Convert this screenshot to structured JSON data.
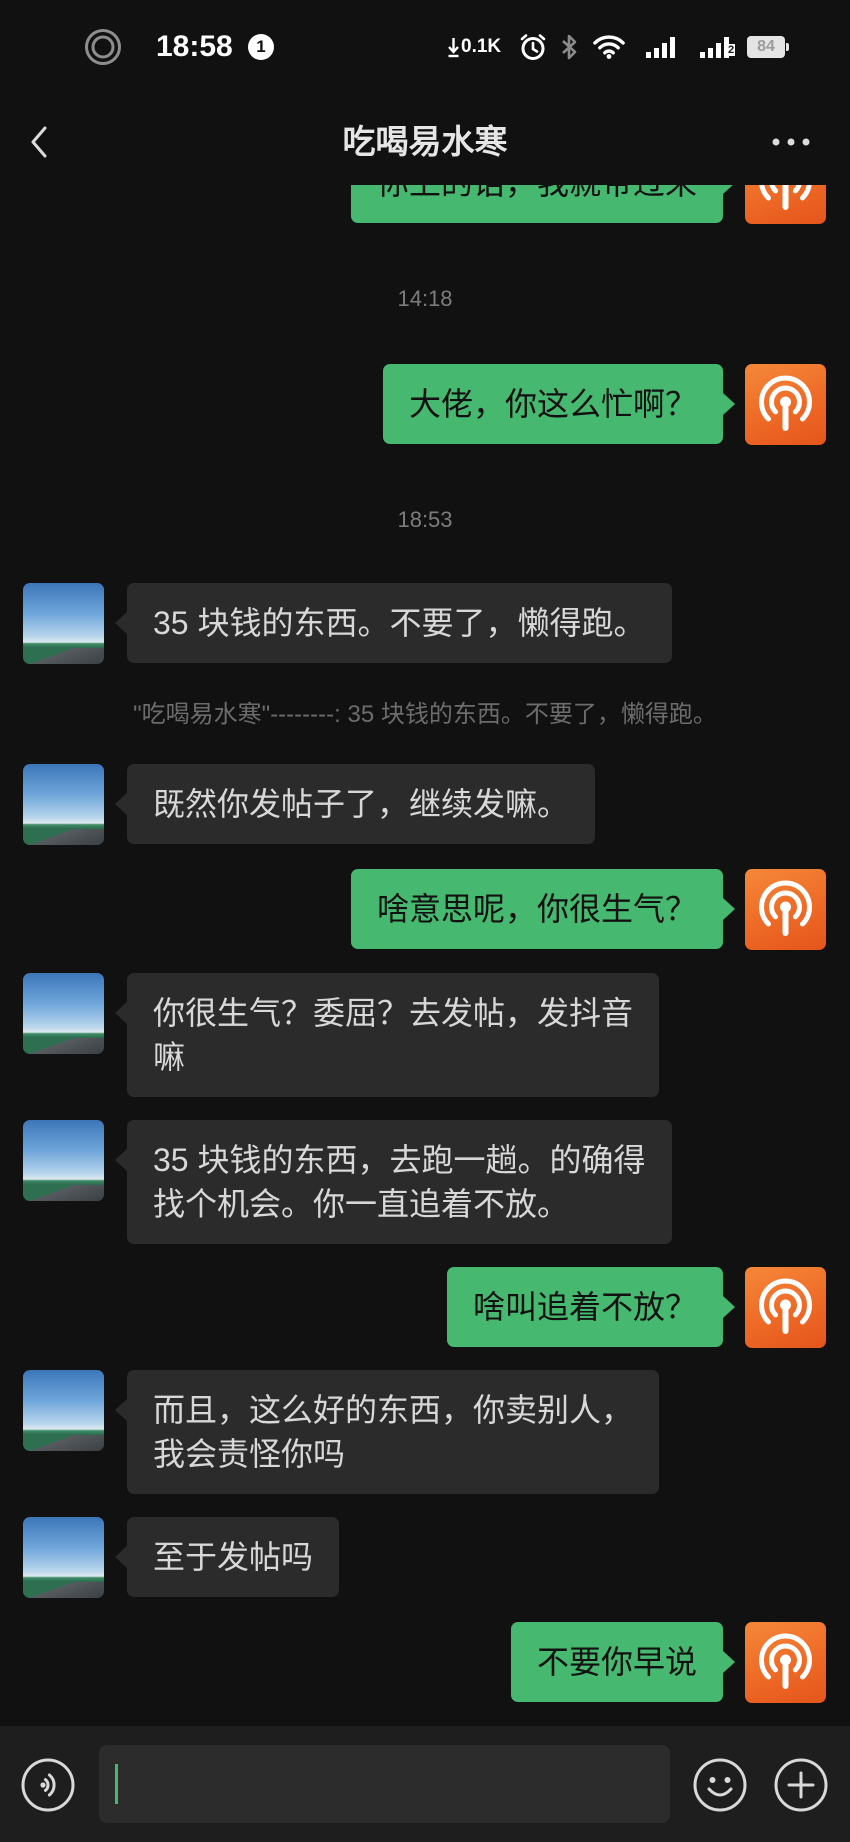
{
  "status_bar": {
    "time": "18:58",
    "notification_badge": "1",
    "net_speed": "0.1K",
    "sim2_label": "2",
    "battery_level": "84",
    "icons": [
      "record-icon",
      "download-arrow-icon",
      "alarm-icon",
      "bluetooth-icon",
      "wifi-icon",
      "signal-icon",
      "signal-sim2-icon",
      "battery-icon"
    ]
  },
  "header": {
    "title": "吃喝易水寒",
    "back_icon": "chevron-left-icon",
    "more_icon": "more-dots-icon"
  },
  "chat": {
    "partial_message": {
      "outgoing": true,
      "lines": [
        "你上的话，我就带过来"
      ]
    },
    "timestamps": [
      "14:18",
      "18:53"
    ],
    "quote": "\"吃喝易水寒\"--------: 35 块钱的东西。不要了，懒得跑。",
    "messages": [
      {
        "outgoing": true,
        "lines": [
          "大佬，你这么忙啊？"
        ]
      },
      {
        "outgoing": false,
        "lines": [
          "35 块钱的东西。不要了，懒得跑。"
        ]
      },
      {
        "outgoing": false,
        "lines": [
          "既然你发帖子了，继续发嘛。"
        ]
      },
      {
        "outgoing": true,
        "lines": [
          "啥意思呢，你很生气？"
        ]
      },
      {
        "outgoing": false,
        "lines": [
          "你很生气？委屈？去发帖，发抖音",
          "嘛"
        ]
      },
      {
        "outgoing": false,
        "lines": [
          "35 块钱的东西，去跑一趟。的确得",
          "找个机会。你一直追着不放。"
        ]
      },
      {
        "outgoing": true,
        "lines": [
          "啥叫追着不放？"
        ]
      },
      {
        "outgoing": false,
        "lines": [
          "而且，这么好的东西，你卖别人，",
          "我会责怪你吗"
        ]
      },
      {
        "outgoing": false,
        "lines": [
          "至于发帖吗"
        ]
      },
      {
        "outgoing": true,
        "lines": [
          "不要你早说"
        ]
      }
    ]
  },
  "avatars": {
    "outgoing_icon": "podcast-icon",
    "incoming_icon": "sky-photo-avatar"
  },
  "input_bar": {
    "value": "",
    "voice_icon": "voice-icon",
    "emoji_icon": "emoji-icon",
    "plus_icon": "plus-icon"
  },
  "colors": {
    "background": "#111111",
    "outgoing_bubble": "#46b86f",
    "incoming_bubble": "#2b2b2b",
    "avatar_orange": "#ee6a26",
    "accent": "#46b86f"
  }
}
